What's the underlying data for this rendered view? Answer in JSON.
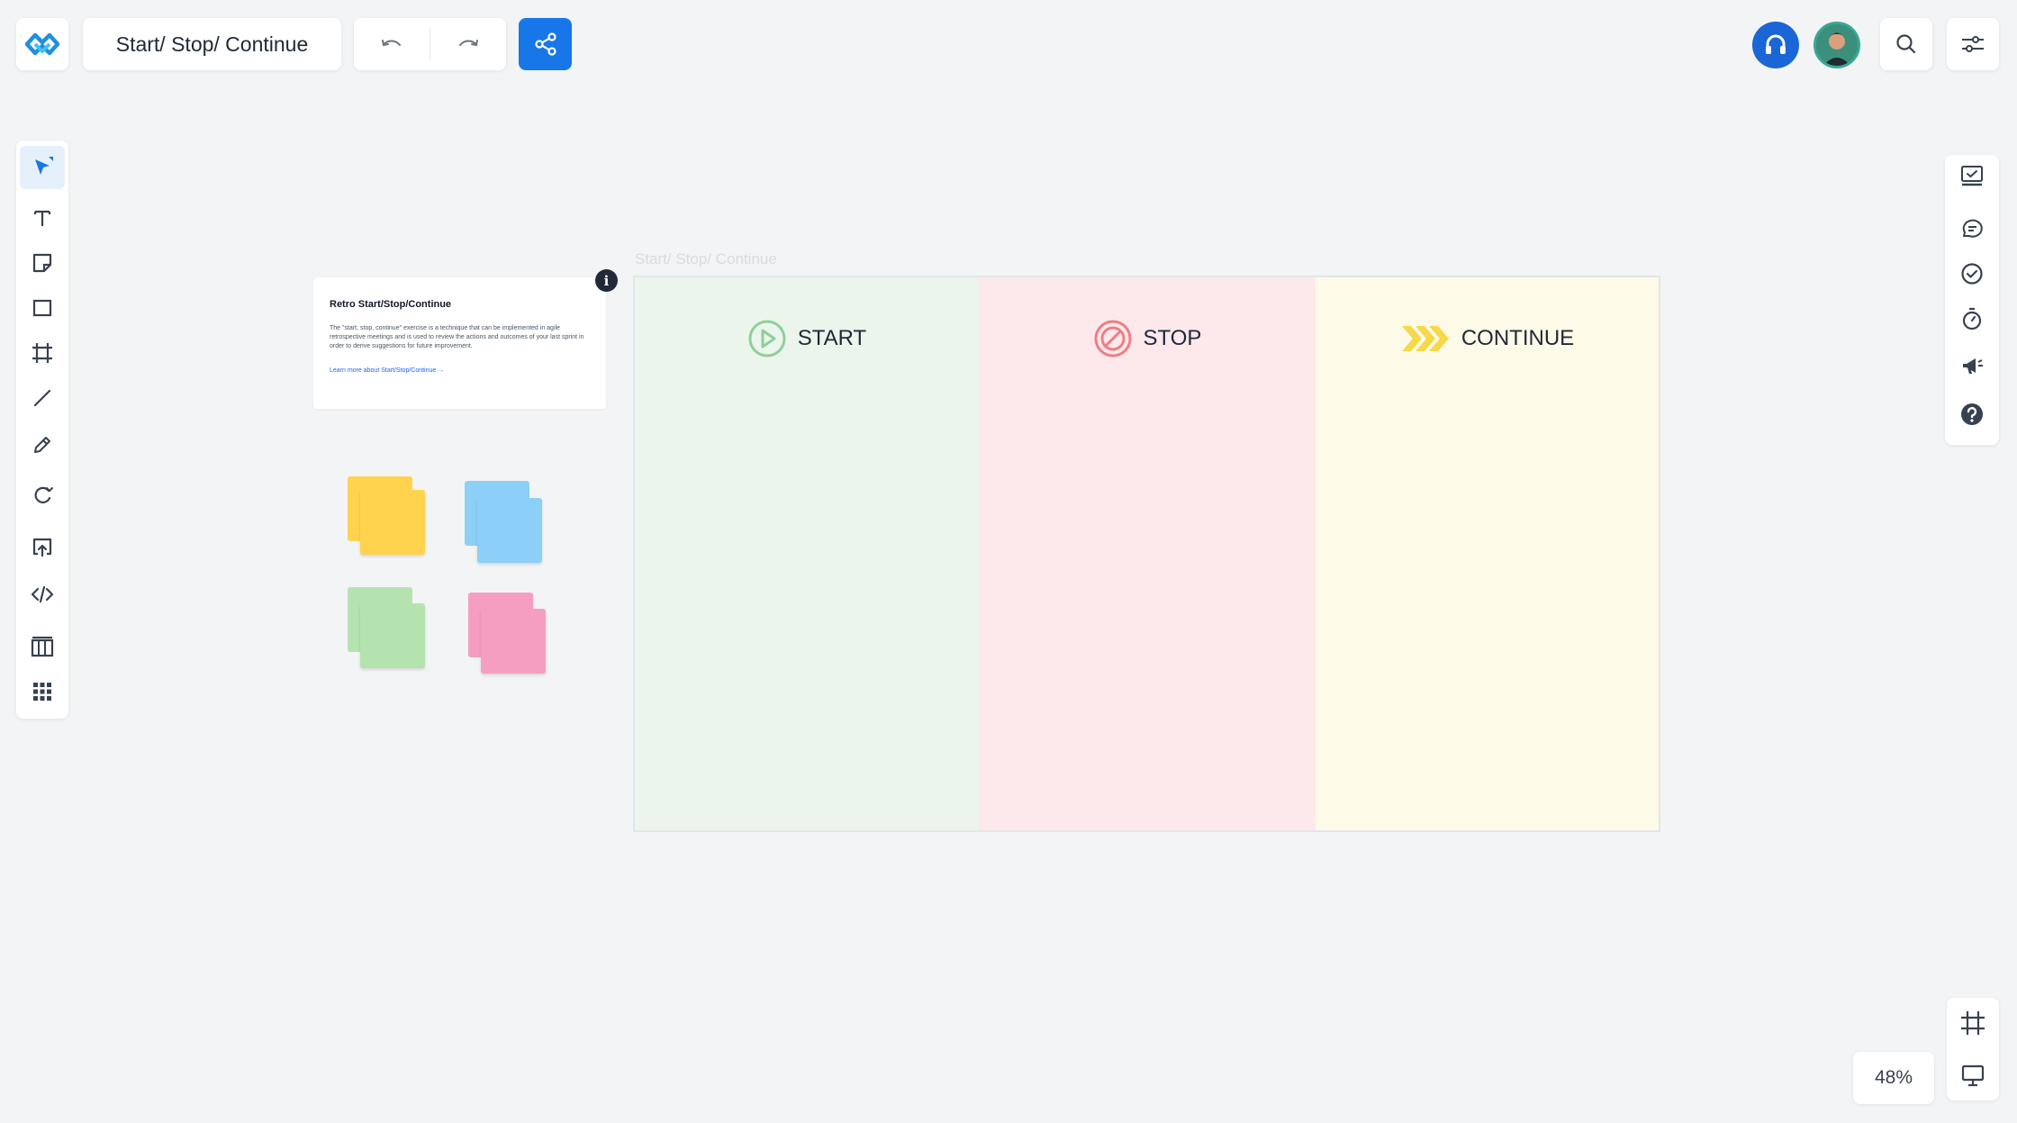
{
  "toolbar": {
    "board_title": "Start/ Stop/ Continue"
  },
  "zoom": {
    "label": "48%"
  },
  "info_card": {
    "title": "Retro Start/Stop/Continue",
    "body": "The \"start, stop, continue\" exercise is a technique that can be implemented in agile retrospective meetings and is used to review the actions and outcomes of your last sprint in order to derive suggestions for future improvement.",
    "link": "Learn more about Start/Stop/Continue →",
    "info_icon": "i"
  },
  "frame": {
    "label": "Start/ Stop/ Continue",
    "columns": [
      {
        "title": "START",
        "icon": "play-circle-icon",
        "color": "#8fcf9a"
      },
      {
        "title": "STOP",
        "icon": "stop-sign-icon",
        "color": "#ee7f82"
      },
      {
        "title": "CONTINUE",
        "icon": "chevrons-right-icon",
        "color": "#f6d84a"
      }
    ]
  },
  "sticky_colors": {
    "yellow": "#ffd34d",
    "blue": "#8ccff7",
    "green": "#b4e3b0",
    "pink": "#f59ec2"
  },
  "colors": {
    "accent": "#1877e8",
    "background": "#f3f4f6"
  }
}
